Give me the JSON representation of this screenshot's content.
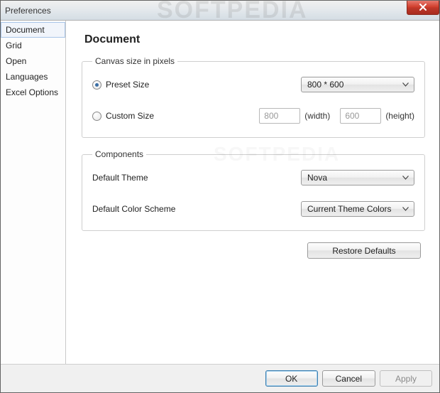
{
  "window": {
    "title": "Preferences",
    "close_icon": "close"
  },
  "watermark": "SOFTPEDIA",
  "sidebar": {
    "items": [
      {
        "label": "Document",
        "selected": true
      },
      {
        "label": "Grid",
        "selected": false
      },
      {
        "label": "Open",
        "selected": false
      },
      {
        "label": "Languages",
        "selected": false
      },
      {
        "label": "Excel Options",
        "selected": false
      }
    ]
  },
  "page": {
    "title": "Document",
    "canvas_group": {
      "legend": "Canvas size in pixels",
      "preset": {
        "label": "Preset Size",
        "checked": true,
        "value": "800 * 600"
      },
      "custom": {
        "label": "Custom Size",
        "checked": false,
        "width_value": "800",
        "height_value": "600",
        "width_hint": "(width)",
        "height_hint": "(height)"
      }
    },
    "components_group": {
      "legend": "Components",
      "theme": {
        "label": "Default Theme",
        "value": "Nova"
      },
      "color_scheme": {
        "label": "Default Color Scheme",
        "value": "Current Theme Colors"
      }
    },
    "restore_label": "Restore Defaults"
  },
  "footer": {
    "ok": "OK",
    "cancel": "Cancel",
    "apply": "Apply"
  }
}
